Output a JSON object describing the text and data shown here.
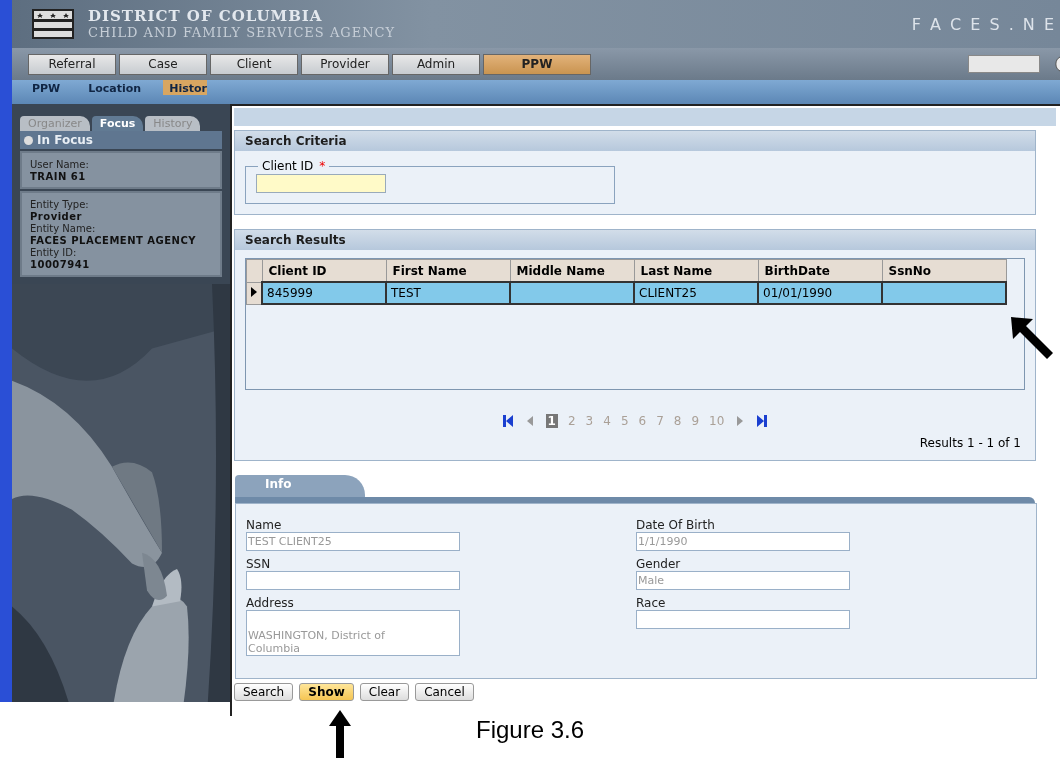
{
  "header": {
    "title": "DISTRICT OF COLUMBIA",
    "subtitle": "CHILD AND FAMILY SERVICES AGENCY",
    "brand": "F A C E S . N E"
  },
  "menu": [
    {
      "label": "Referral",
      "selected": false
    },
    {
      "label": "Case",
      "selected": false
    },
    {
      "label": "Client",
      "selected": false
    },
    {
      "label": "Provider",
      "selected": false
    },
    {
      "label": "Admin",
      "selected": false
    },
    {
      "label": "PPW",
      "selected": true
    }
  ],
  "breadcrumbs": [
    {
      "label": "PPW",
      "selected": false
    },
    {
      "label": "Location",
      "selected": false
    },
    {
      "label": "Histor",
      "selected": true
    }
  ],
  "sidebar": {
    "tabs": [
      {
        "label": "Organizer",
        "selected": false
      },
      {
        "label": "Focus",
        "selected": true
      },
      {
        "label": "History",
        "selected": false
      }
    ],
    "section_title": "In Focus",
    "groups": [
      [
        {
          "label": "User Name:",
          "value": "TRAIN 61"
        }
      ],
      [
        {
          "label": "Entity Type:",
          "value": "Provider"
        },
        {
          "label": "Entity Name:",
          "value": "FACES PLACEMENT AGENCY"
        },
        {
          "label": "Entity ID:",
          "value": "10007941"
        }
      ]
    ]
  },
  "search_criteria": {
    "title": "Search Criteria",
    "field": {
      "label": "Client ID",
      "required": true,
      "required_mark": "*"
    }
  },
  "search_results": {
    "title": "Search Results",
    "columns": [
      "Client ID",
      "First Name",
      "Middle Name",
      "Last Name",
      "BirthDate",
      "SsnNo"
    ],
    "rows": [
      {
        "selected": true,
        "cells": [
          "845999",
          "TEST",
          null,
          "CLIENT25",
          "01/01/1990",
          null
        ]
      }
    ],
    "pager": {
      "pages": [
        {
          "label": "1",
          "selected": true
        },
        {
          "label": "2",
          "selected": false
        },
        {
          "label": "3",
          "selected": false
        },
        {
          "label": "4",
          "selected": false
        },
        {
          "label": "5",
          "selected": false
        },
        {
          "label": "6",
          "selected": false
        },
        {
          "label": "7",
          "selected": false
        },
        {
          "label": "8",
          "selected": false
        },
        {
          "label": "9",
          "selected": false
        },
        {
          "label": "10",
          "selected": false
        }
      ],
      "summary": "Results 1 - 1 of 1"
    }
  },
  "info": {
    "tab": "Info",
    "columns": [
      [
        {
          "label": "Name",
          "kind": "input",
          "value": "TEST CLIENT25"
        },
        {
          "label": "SSN",
          "kind": "input"
        },
        {
          "label": "Address",
          "kind": "textarea",
          "value": "WASHINGTON, District of Columbia"
        }
      ],
      [
        {
          "label": "Date Of Birth",
          "kind": "input",
          "value": "1/1/1990"
        },
        {
          "label": "Gender",
          "kind": "input",
          "value": "Male"
        },
        {
          "label": "Race",
          "kind": "input"
        }
      ]
    ]
  },
  "buttons": [
    {
      "label": "Search",
      "selected": false
    },
    {
      "label": "Show",
      "selected": true
    },
    {
      "label": "Clear",
      "selected": false
    },
    {
      "label": "Cancel",
      "selected": false
    }
  ],
  "caption": "Figure 3.6"
}
